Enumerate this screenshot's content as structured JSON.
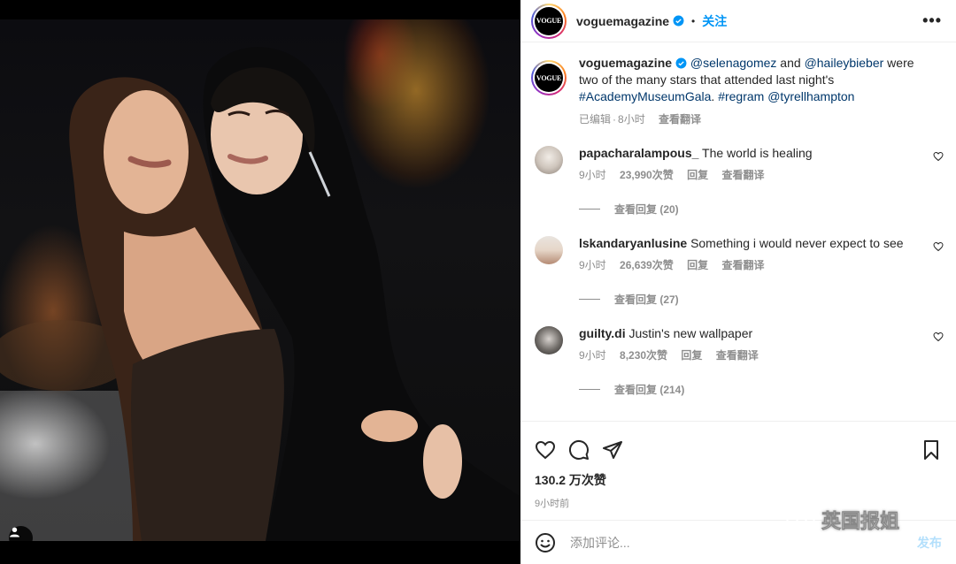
{
  "post": {
    "username": "voguemagazine",
    "avatar_text": "VOGUE",
    "follow_label": "关注",
    "more_label": "•••"
  },
  "caption": {
    "username": "voguemagazine",
    "mention1": "@selenagomez",
    "and_text": " and ",
    "mention2": "@haileybieber",
    "text1": " were two of the many stars that attended last night's ",
    "hashtag1": "#AcademyMuseumGala",
    "text2": ". ",
    "hashtag2": "#regram",
    "text3": " ",
    "mention3": "@tyrellhampton",
    "edited": "已编辑",
    "separator": "·",
    "age": "8小时",
    "translate": "查看翻译"
  },
  "comments": [
    {
      "username": "papacharalampous_",
      "text": "The world is healing",
      "age": "9小时",
      "likes": "23,990次赞",
      "reply": "回复",
      "translate": "查看翻译",
      "replies": "查看回复 (20)"
    },
    {
      "username": "lskandaryanlusine",
      "text": "Something i would never expect to see",
      "age": "9小时",
      "likes": "26,639次赞",
      "reply": "回复",
      "translate": "查看翻译",
      "replies": "查看回复 (27)"
    },
    {
      "username": "guilty.di",
      "text": "Justin's new wallpaper",
      "age": "9小时",
      "likes": "8,230次赞",
      "reply": "回复",
      "translate": "查看翻译",
      "replies": "查看回复 (214)"
    }
  ],
  "stats": {
    "likes": "130.2 万次赞",
    "time": "9小时前"
  },
  "add_comment": {
    "placeholder": "添加评论...",
    "post_label": "发布"
  },
  "watermark": {
    "text": "英国报姐"
  },
  "colors": {
    "link": "#00376b",
    "follow": "#0095f6",
    "verified": "#0095f6",
    "muted": "#8e8e8e"
  }
}
